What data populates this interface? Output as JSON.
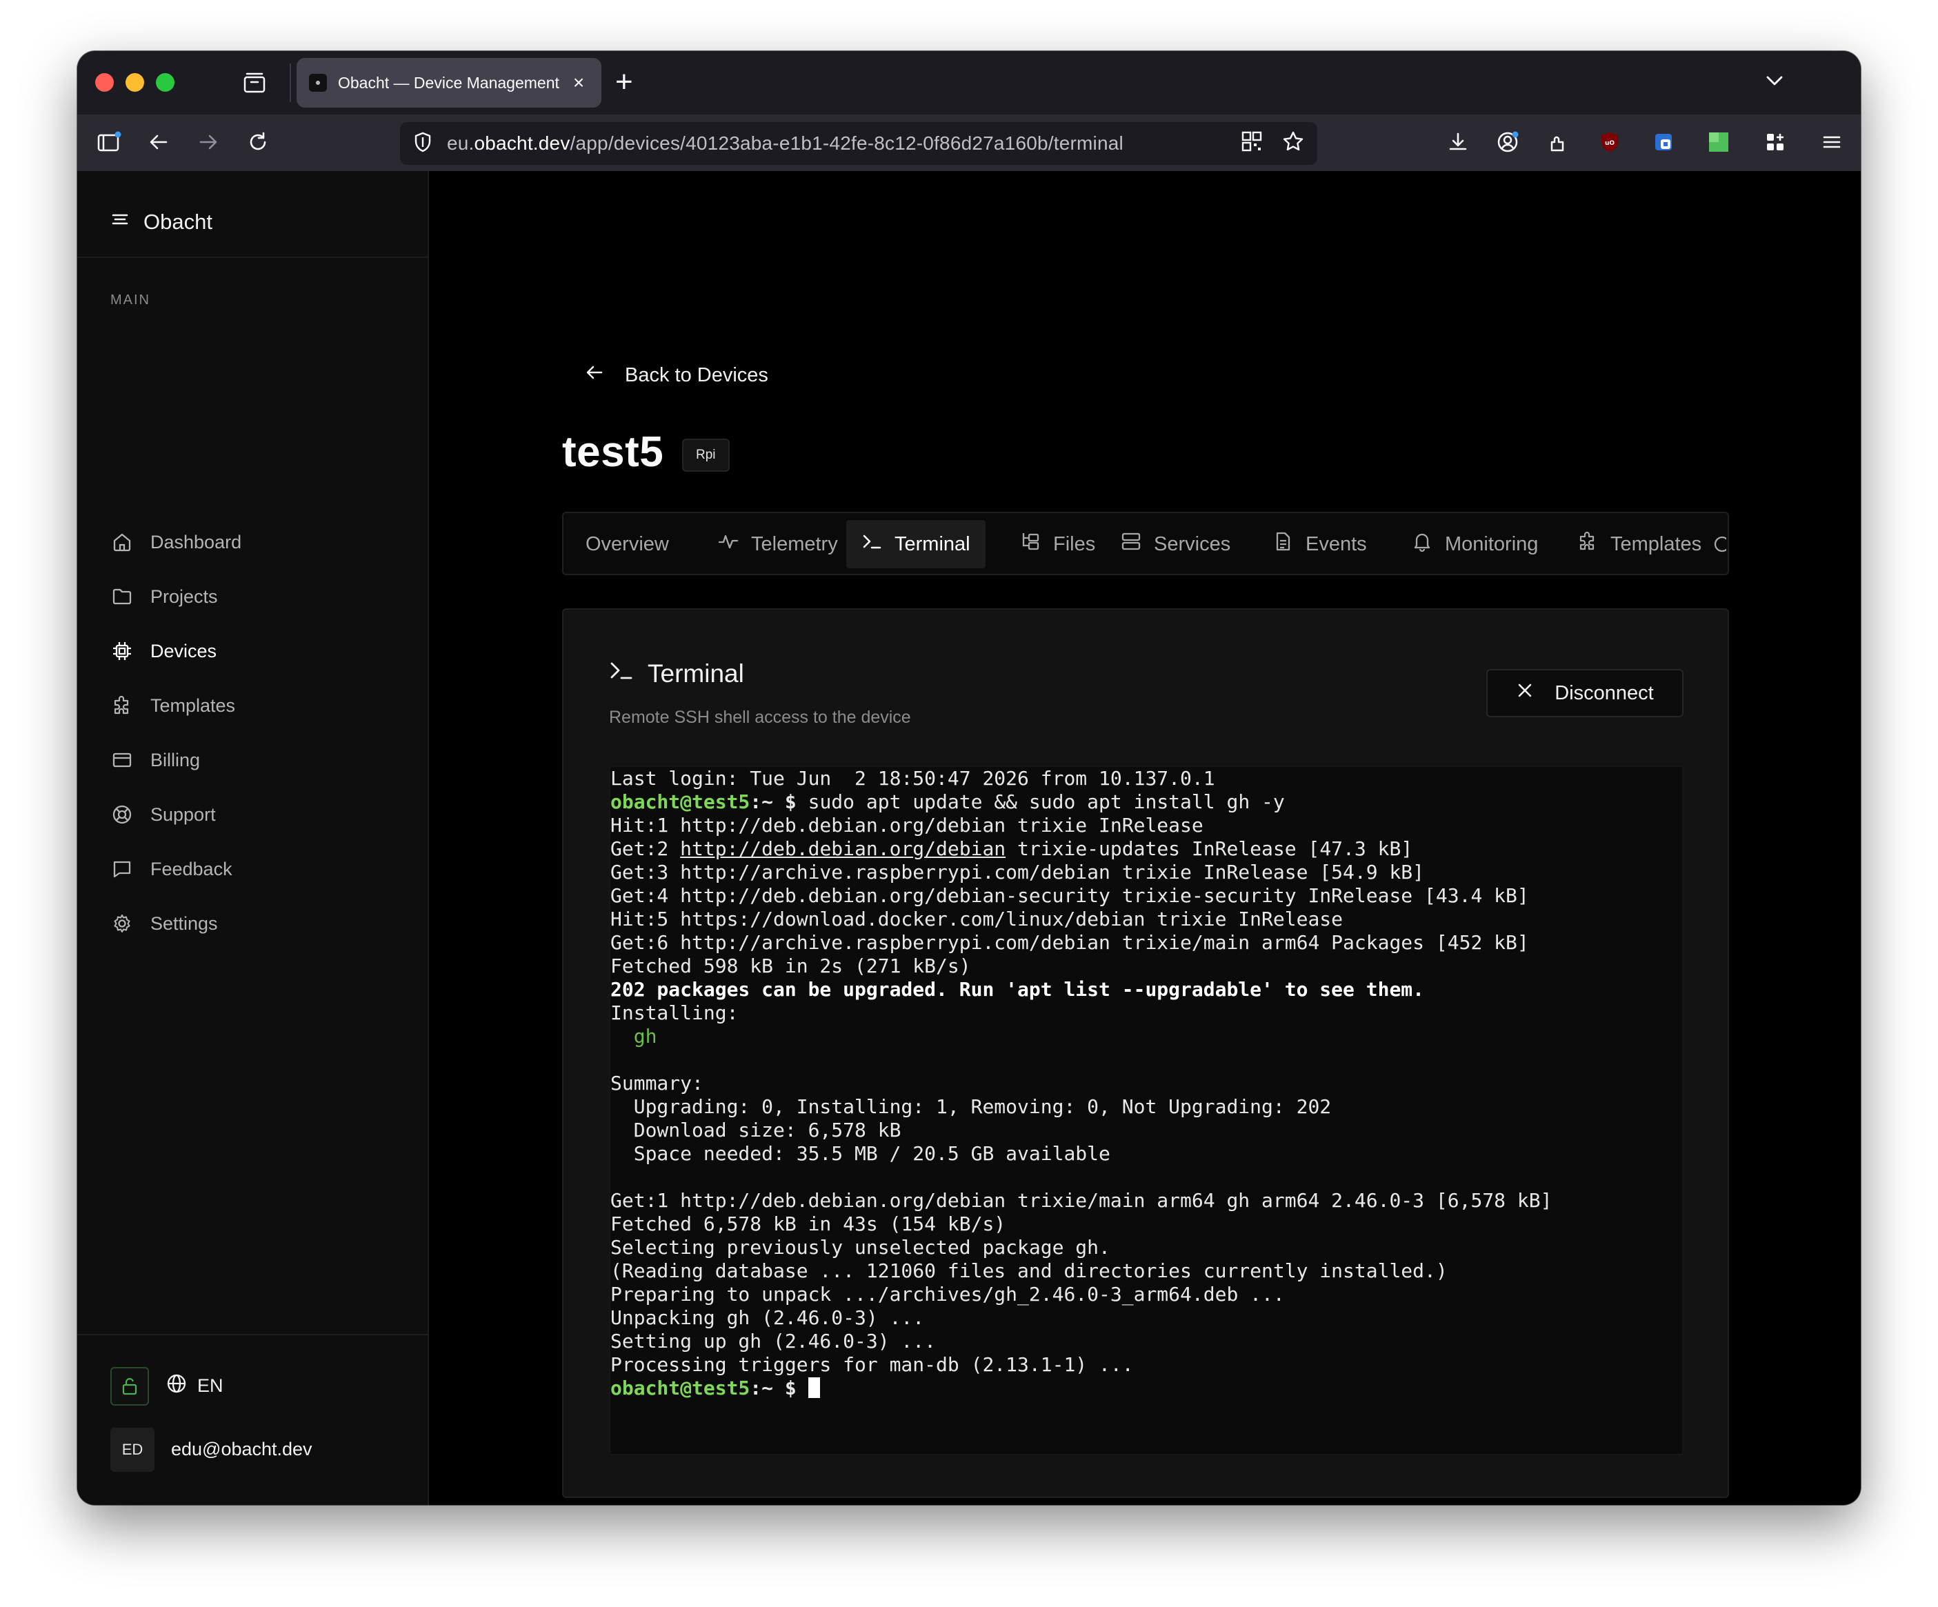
{
  "browser": {
    "tab_title": "Obacht — Device Management",
    "url_prefix": "eu.",
    "url_domain": "obacht.dev",
    "url_path": "/app/devices/40123aba-e1b1-42fe-8c12-0f86d27a160b/terminal"
  },
  "sidebar": {
    "brand": "Obacht",
    "section_label": "MAIN",
    "items": [
      {
        "label": "Dashboard",
        "icon": "home-icon"
      },
      {
        "label": "Projects",
        "icon": "folder-icon"
      },
      {
        "label": "Devices",
        "icon": "chip-icon",
        "active": true
      },
      {
        "label": "Templates",
        "icon": "puzzle-icon"
      },
      {
        "label": "Billing",
        "icon": "credit-card-icon"
      },
      {
        "label": "Support",
        "icon": "lifebuoy-icon"
      },
      {
        "label": "Feedback",
        "icon": "message-icon"
      },
      {
        "label": "Settings",
        "icon": "gear-icon"
      }
    ],
    "language": "EN",
    "user_initials": "ED",
    "user_email": "edu@obacht.dev"
  },
  "main": {
    "back_label": "Back to Devices",
    "device_name": "test5",
    "device_badge": "Rpi",
    "tabs": [
      {
        "label": "Overview"
      },
      {
        "label": "Telemetry"
      },
      {
        "label": "Terminal",
        "active": true
      },
      {
        "label": "Files"
      },
      {
        "label": "Services"
      },
      {
        "label": "Events"
      },
      {
        "label": "Monitoring"
      },
      {
        "label": "Templates"
      }
    ],
    "panel": {
      "title": "Terminal",
      "subtitle": "Remote SSH shell access to the device",
      "disconnect_label": "Disconnect"
    }
  },
  "terminal": {
    "prompt": "obacht@test5",
    "prompt_suffix": ":~ $ ",
    "lines": [
      "Last login: Tue Jun  2 18:50:47 2026 from 10.137.0.1",
      "sudo apt update && sudo apt install gh -y",
      "Hit:1 http://deb.debian.org/debian trixie InRelease",
      "Get:2 ",
      "http://deb.debian.org/debian",
      " trixie-updates InRelease [47.3 kB]",
      "Get:3 http://archive.raspberrypi.com/debian trixie InRelease [54.9 kB]",
      "Get:4 http://deb.debian.org/debian-security trixie-security InRelease [43.4 kB]",
      "Hit:5 https://download.docker.com/linux/debian trixie InRelease",
      "Get:6 http://archive.raspberrypi.com/debian trixie/main arm64 Packages [452 kB]",
      "Fetched 598 kB in 2s (271 kB/s)",
      "202 packages can be upgraded. Run 'apt list --upgradable' to see them.",
      "Installing:",
      "  gh",
      "",
      "Summary:",
      "  Upgrading: 0, Installing: 1, Removing: 0, Not Upgrading: 202",
      "  Download size: 6,578 kB",
      "  Space needed: 35.5 MB / 20.5 GB available",
      "",
      "Get:1 http://deb.debian.org/debian trixie/main arm64 gh arm64 2.46.0-3 [6,578 kB]",
      "Fetched 6,578 kB in 43s (154 kB/s)",
      "Selecting previously unselected package gh.",
      "(Reading database ... 121060 files and directories currently installed.)",
      "Preparing to unpack .../archives/gh_2.46.0-3_arm64.deb ...",
      "Unpacking gh (2.46.0-3) ...",
      "Setting up gh (2.46.0-3) ...",
      "Processing triggers for man-db (2.13.1-1) ..."
    ]
  },
  "colors": {
    "prompt_green": "#7ed957",
    "package_green": "#6abf4b",
    "background": "#000000",
    "sidebar_bg": "#0e0e0e"
  }
}
